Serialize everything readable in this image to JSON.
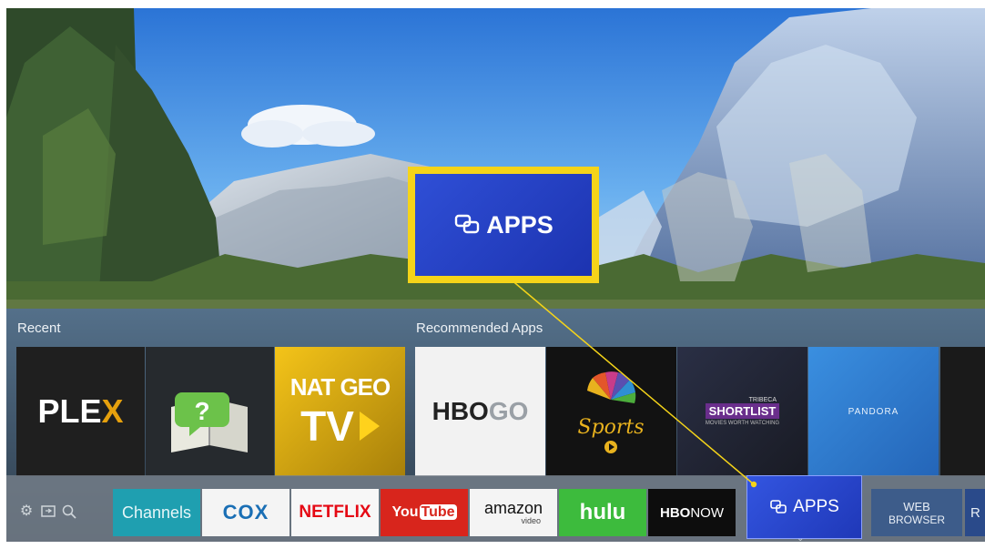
{
  "recent": {
    "title": "Recent",
    "tiles": [
      {
        "name": "plex-tile",
        "label_main": "PLE",
        "label_accent": "X"
      },
      {
        "name": "help-book-tile",
        "glyph": "?"
      },
      {
        "name": "natgeo-tv-tile",
        "line1": "NAT GEO",
        "line2": "TV"
      }
    ]
  },
  "recommended": {
    "title": "Recommended Apps",
    "tiles": [
      {
        "name": "hbo-go-tile",
        "label_a": "HBO",
        "label_b": "GO"
      },
      {
        "name": "nbc-sports-tile",
        "label": "Sports"
      },
      {
        "name": "tribeca-shortlist-tile",
        "label_top": "TRIBECA",
        "label": "SHORTLIST",
        "sub": "MOVIES WORTH WATCHING"
      },
      {
        "name": "pandora-tile",
        "label": "PANDORA"
      }
    ]
  },
  "bar": {
    "apps": [
      {
        "label": "Channels"
      },
      {
        "label": "COX"
      },
      {
        "label": "NETFLIX"
      },
      {
        "label_a": "You",
        "label_b": "Tube"
      },
      {
        "label": "amazon",
        "sub": "video"
      },
      {
        "label": "hulu"
      },
      {
        "label_a": "HBO",
        "label_b": "NOW"
      }
    ],
    "apps_label": "APPS",
    "web_browser": {
      "line1": "WEB",
      "line2": "BROWSER"
    },
    "partial_label": "R"
  },
  "zoom": {
    "label": "APPS"
  },
  "colors": {
    "highlight_yellow": "#f5d419",
    "apps_blue": "#2545d0",
    "plex_orange": "#e5a00d",
    "netflix_red": "#e50914",
    "youtube_red": "#d8251c",
    "hulu_green": "#3dbb3d",
    "channels_teal": "#1f9fb0"
  },
  "icons": [
    "settings-icon",
    "input-source-icon",
    "search-icon",
    "apps-icon",
    "chevron-down-icon"
  ]
}
